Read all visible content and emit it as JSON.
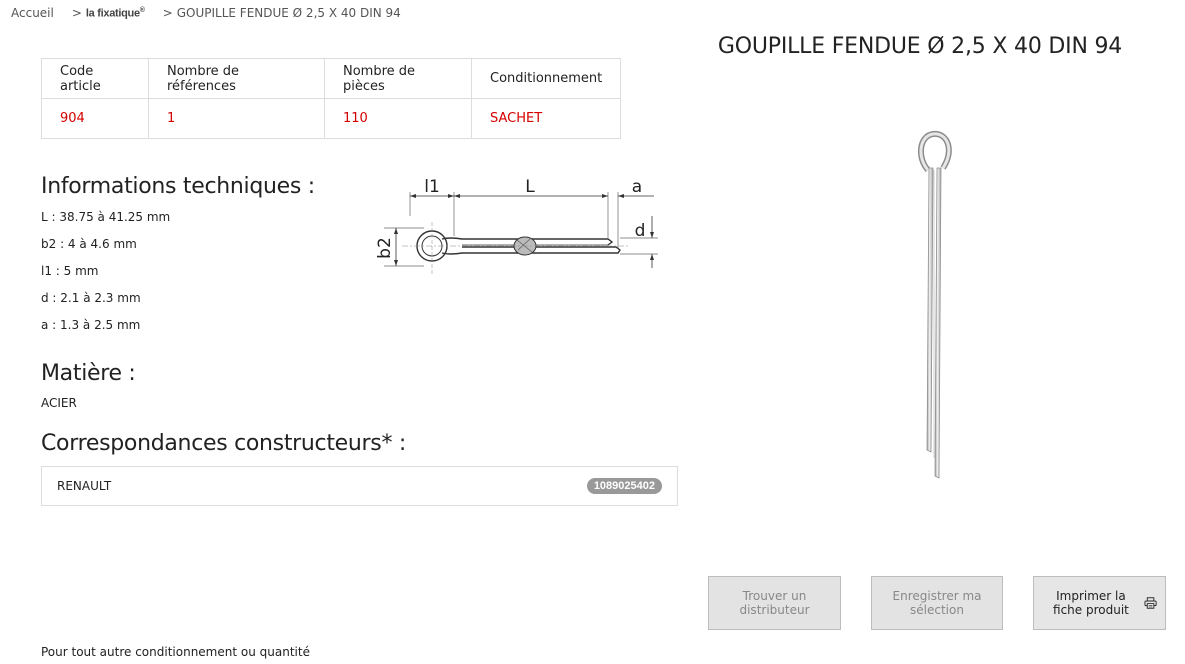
{
  "breadcrumb": {
    "home": "Accueil",
    "separator": ">",
    "brand": "la fixatique",
    "brand_mark": "®",
    "current": "GOUPILLE FENDUE Ø 2,5 X 40 DIN 94"
  },
  "product_table": {
    "headers": [
      "Code article",
      "Nombre de références",
      "Nombre de pièces",
      "Conditionnement"
    ],
    "values": [
      "904",
      "1",
      "110",
      "SACHET"
    ]
  },
  "tech_info": {
    "title": "Informations techniques :",
    "specs": [
      "L : 38.75 à 41.25 mm",
      "b2 : 4 à 4.6 mm",
      "l1 : 5 mm",
      "d : 2.1 à 2.3 mm",
      "a : 1.3 à 2.5 mm"
    ],
    "diagram_labels": {
      "l1": "l1",
      "L": "L",
      "a": "a",
      "d": "d",
      "b2": "b2"
    }
  },
  "material": {
    "title": "Matière :",
    "value": "ACIER"
  },
  "correspondences": {
    "title": "Correspondances constructeurs* :",
    "items": [
      {
        "brand": "RENAULT",
        "reference": "1089025402"
      }
    ]
  },
  "product": {
    "title": "GOUPILLE FENDUE Ø 2,5 X 40 DIN 94"
  },
  "actions": {
    "find_distributor": "Trouver un distributeur",
    "save_selection": "Enregistrer ma sélection",
    "print_sheet": "Imprimer la fiche produit"
  },
  "footer": {
    "note": "Pour tout autre conditionnement ou quantité"
  },
  "colors": {
    "accent_red": "#d40000",
    "badge_grey": "#999999",
    "button_grey": "#e3e3e3"
  }
}
